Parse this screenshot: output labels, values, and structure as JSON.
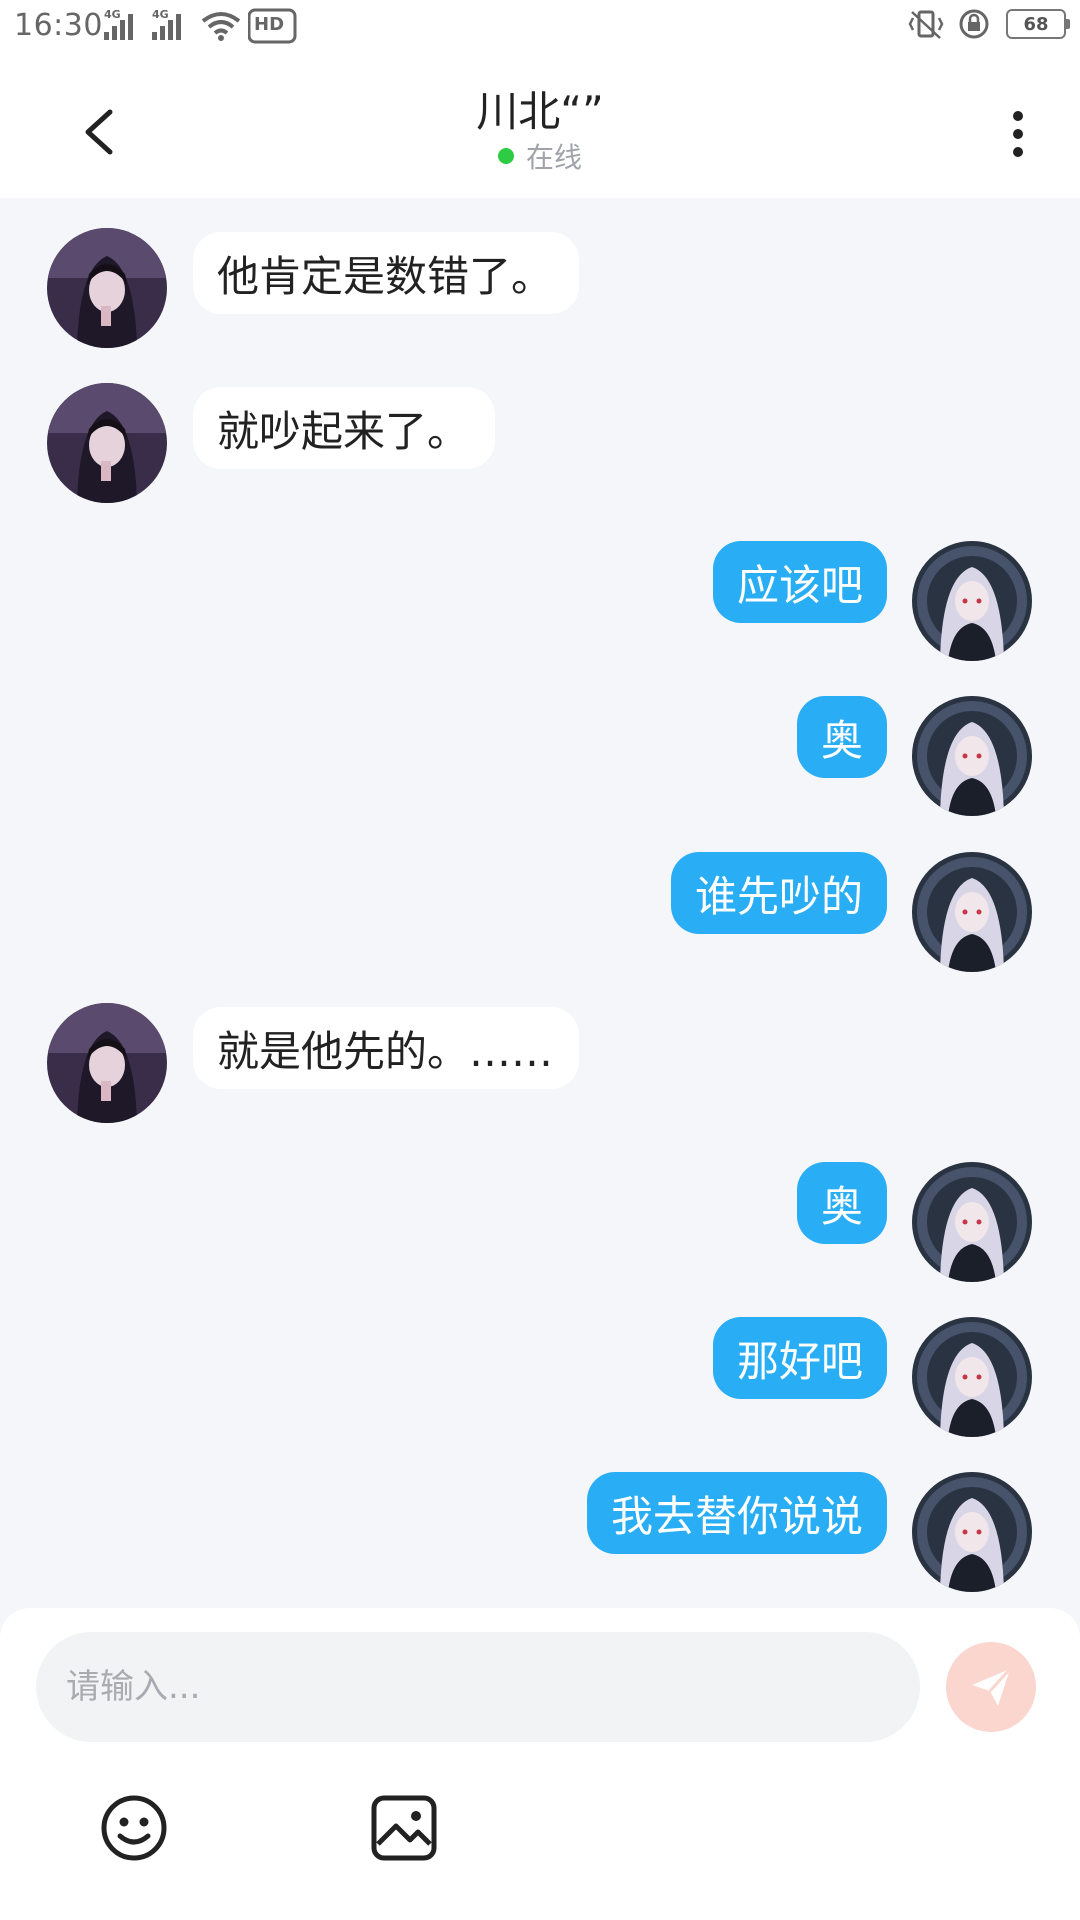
{
  "status_bar": {
    "time": "16:30",
    "network_1": "4G",
    "network_2": "4G",
    "hd_label": "HD",
    "battery": "68",
    "icons": [
      "signal-icon",
      "wifi-icon",
      "hd-icon",
      "vibrate-icon",
      "rotation-lock-icon",
      "battery-icon"
    ]
  },
  "header": {
    "title": "川北“”",
    "status": "在线",
    "status_color": "#2ecb45",
    "icons": [
      "back-icon",
      "more-icon"
    ]
  },
  "messages": [
    {
      "side": "in",
      "text": "他肯定是数错了。"
    },
    {
      "side": "in",
      "text": "就吵起来了。"
    },
    {
      "side": "out",
      "text": "应该吧"
    },
    {
      "side": "out",
      "text": "奥"
    },
    {
      "side": "out",
      "text": "谁先吵的"
    },
    {
      "side": "in",
      "text": "就是他先的。……"
    },
    {
      "side": "out",
      "text": "奥"
    },
    {
      "side": "out",
      "text": "那好吧"
    },
    {
      "side": "out",
      "text": "我去替你说说"
    }
  ],
  "input": {
    "placeholder": "请输入...",
    "value": ""
  },
  "toolbar": {
    "icons": [
      "send-icon",
      "emoji-icon",
      "image-icon"
    ]
  },
  "colors": {
    "outgoing_bubble": "#29aef5",
    "incoming_bubble": "#ffffff",
    "background": "#f4f6f9",
    "send_button": "#fbd6cf"
  }
}
